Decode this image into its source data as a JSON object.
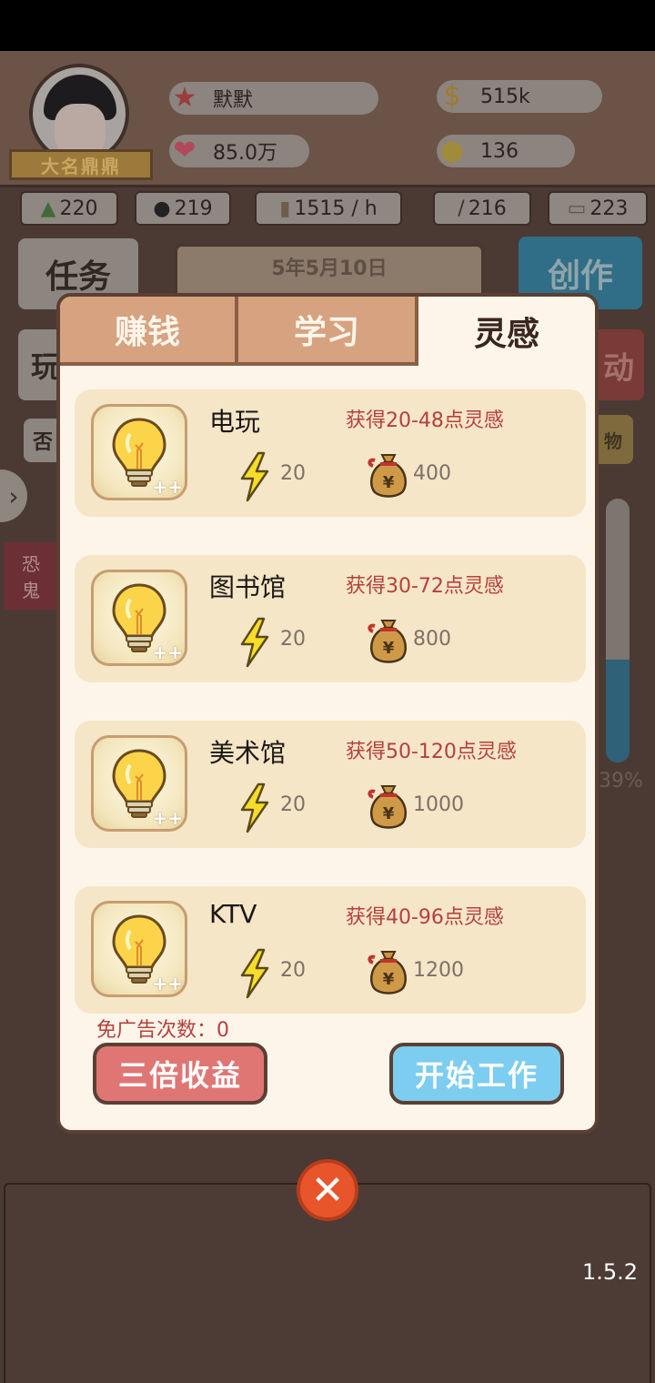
{
  "player": {
    "name": "默默",
    "title": "大名鼎鼎",
    "fans": "85.0万",
    "money": "515k",
    "inspiration": "136"
  },
  "stats": [
    {
      "icon": "mountain-icon",
      "value": "220"
    },
    {
      "icon": "hat-icon",
      "value": "219"
    },
    {
      "icon": "scroll-icon",
      "value": "1515 / h"
    },
    {
      "icon": "brush-icon",
      "value": "216"
    },
    {
      "icon": "book-icon",
      "value": "223"
    }
  ],
  "background": {
    "date": "5年5月10日",
    "left_buttons": [
      "任务",
      "玩",
      "否"
    ],
    "right_buttons": [
      "创作",
      "动",
      "物"
    ],
    "side_tag": [
      "恐",
      "鬼"
    ],
    "progress_percent": 39,
    "progress_label": "39%"
  },
  "dialog": {
    "tabs": [
      {
        "label": "赚钱",
        "active": false
      },
      {
        "label": "学习",
        "active": false
      },
      {
        "label": "灵感",
        "active": true
      }
    ],
    "items": [
      {
        "title": "电玩",
        "gain": "获得20-48点灵感",
        "energy": "20",
        "cost": "400"
      },
      {
        "title": "图书馆",
        "gain": "获得30-72点灵感",
        "energy": "20",
        "cost": "800"
      },
      {
        "title": "美术馆",
        "gain": "获得50-120点灵感",
        "energy": "20",
        "cost": "1000"
      },
      {
        "title": "KTV",
        "gain": "获得40-96点灵感",
        "energy": "20",
        "cost": "1200"
      }
    ],
    "item_badge": "++",
    "ad_count": "免广告次数：0",
    "triple_button": "三倍收益",
    "start_button": "开始工作"
  },
  "version": "1.5.2",
  "colors": {
    "accent_red": "#e07674",
    "accent_blue": "#7ccdef",
    "gain_text": "#b6403c",
    "card_bg": "#f5e6c8"
  }
}
